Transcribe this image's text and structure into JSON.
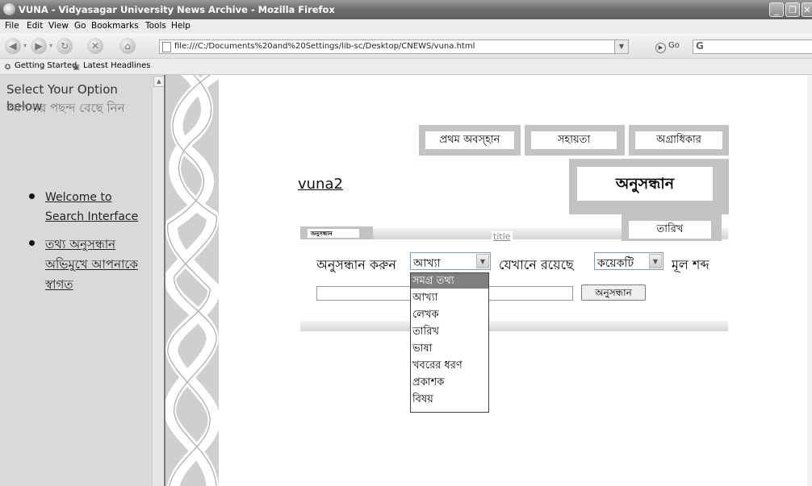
{
  "window": {
    "title": "VUNA - Vidyasagar University News Archive - Mozilla Firefox",
    "buttons": [
      "minimize",
      "restore",
      "close"
    ]
  },
  "menu": {
    "items": [
      "File",
      "Edit",
      "View",
      "Go",
      "Bookmarks",
      "Tools",
      "Help"
    ]
  },
  "navigation": {
    "url": "file:///C:/Documents%20and%20Settings/lib-sc/Desktop/CNEWS/vuna.html",
    "go_label": "Go",
    "search_label": "G"
  },
  "bookmarks": {
    "items": [
      "Getting Started",
      "Latest Headlines"
    ]
  },
  "sidebar": {
    "heading": "Select Your Option below",
    "heading_bn": "আপনার পছন্দ বেছে নিন",
    "items": [
      {
        "label": "Welcome to Search Interface"
      },
      {
        "label": "তথ্য অনুসন্ধান অভিমুখে আপনাকে স্বাগত"
      }
    ]
  },
  "topnav": {
    "items": [
      "প্রথম অবস্হান",
      "সহায়তা",
      "অগ্রাধিকার"
    ]
  },
  "page": {
    "site_link": "vuna2",
    "search_heading": "অনুসন্ধান",
    "small_tab": "অনুসন্ধান",
    "title_link": "title",
    "date_tab": "তারিখ"
  },
  "search_form": {
    "label_search": "অনুসন্ধান করুন",
    "field_selected": "আখ্যা",
    "label_where": "যেখানে রয়েছে",
    "match_selected": "কয়েকটি",
    "label_keyword": "মূল শব্দ",
    "query_value": "",
    "submit_label": "অনুসন্ধান",
    "field_options": [
      "সমগ্র তথ্য",
      "আখ্যা",
      "লেখক",
      "তারিখ",
      "ভাষা",
      "খবরের ধরণ",
      "প্রকাশক",
      "বিষয়"
    ],
    "highlighted_option": "সমগ্র তথ্য"
  },
  "colors": {
    "tab_gray": "#c3c3c3",
    "sidebar_bg": "#d9d9d9",
    "highlight": "#808080"
  }
}
